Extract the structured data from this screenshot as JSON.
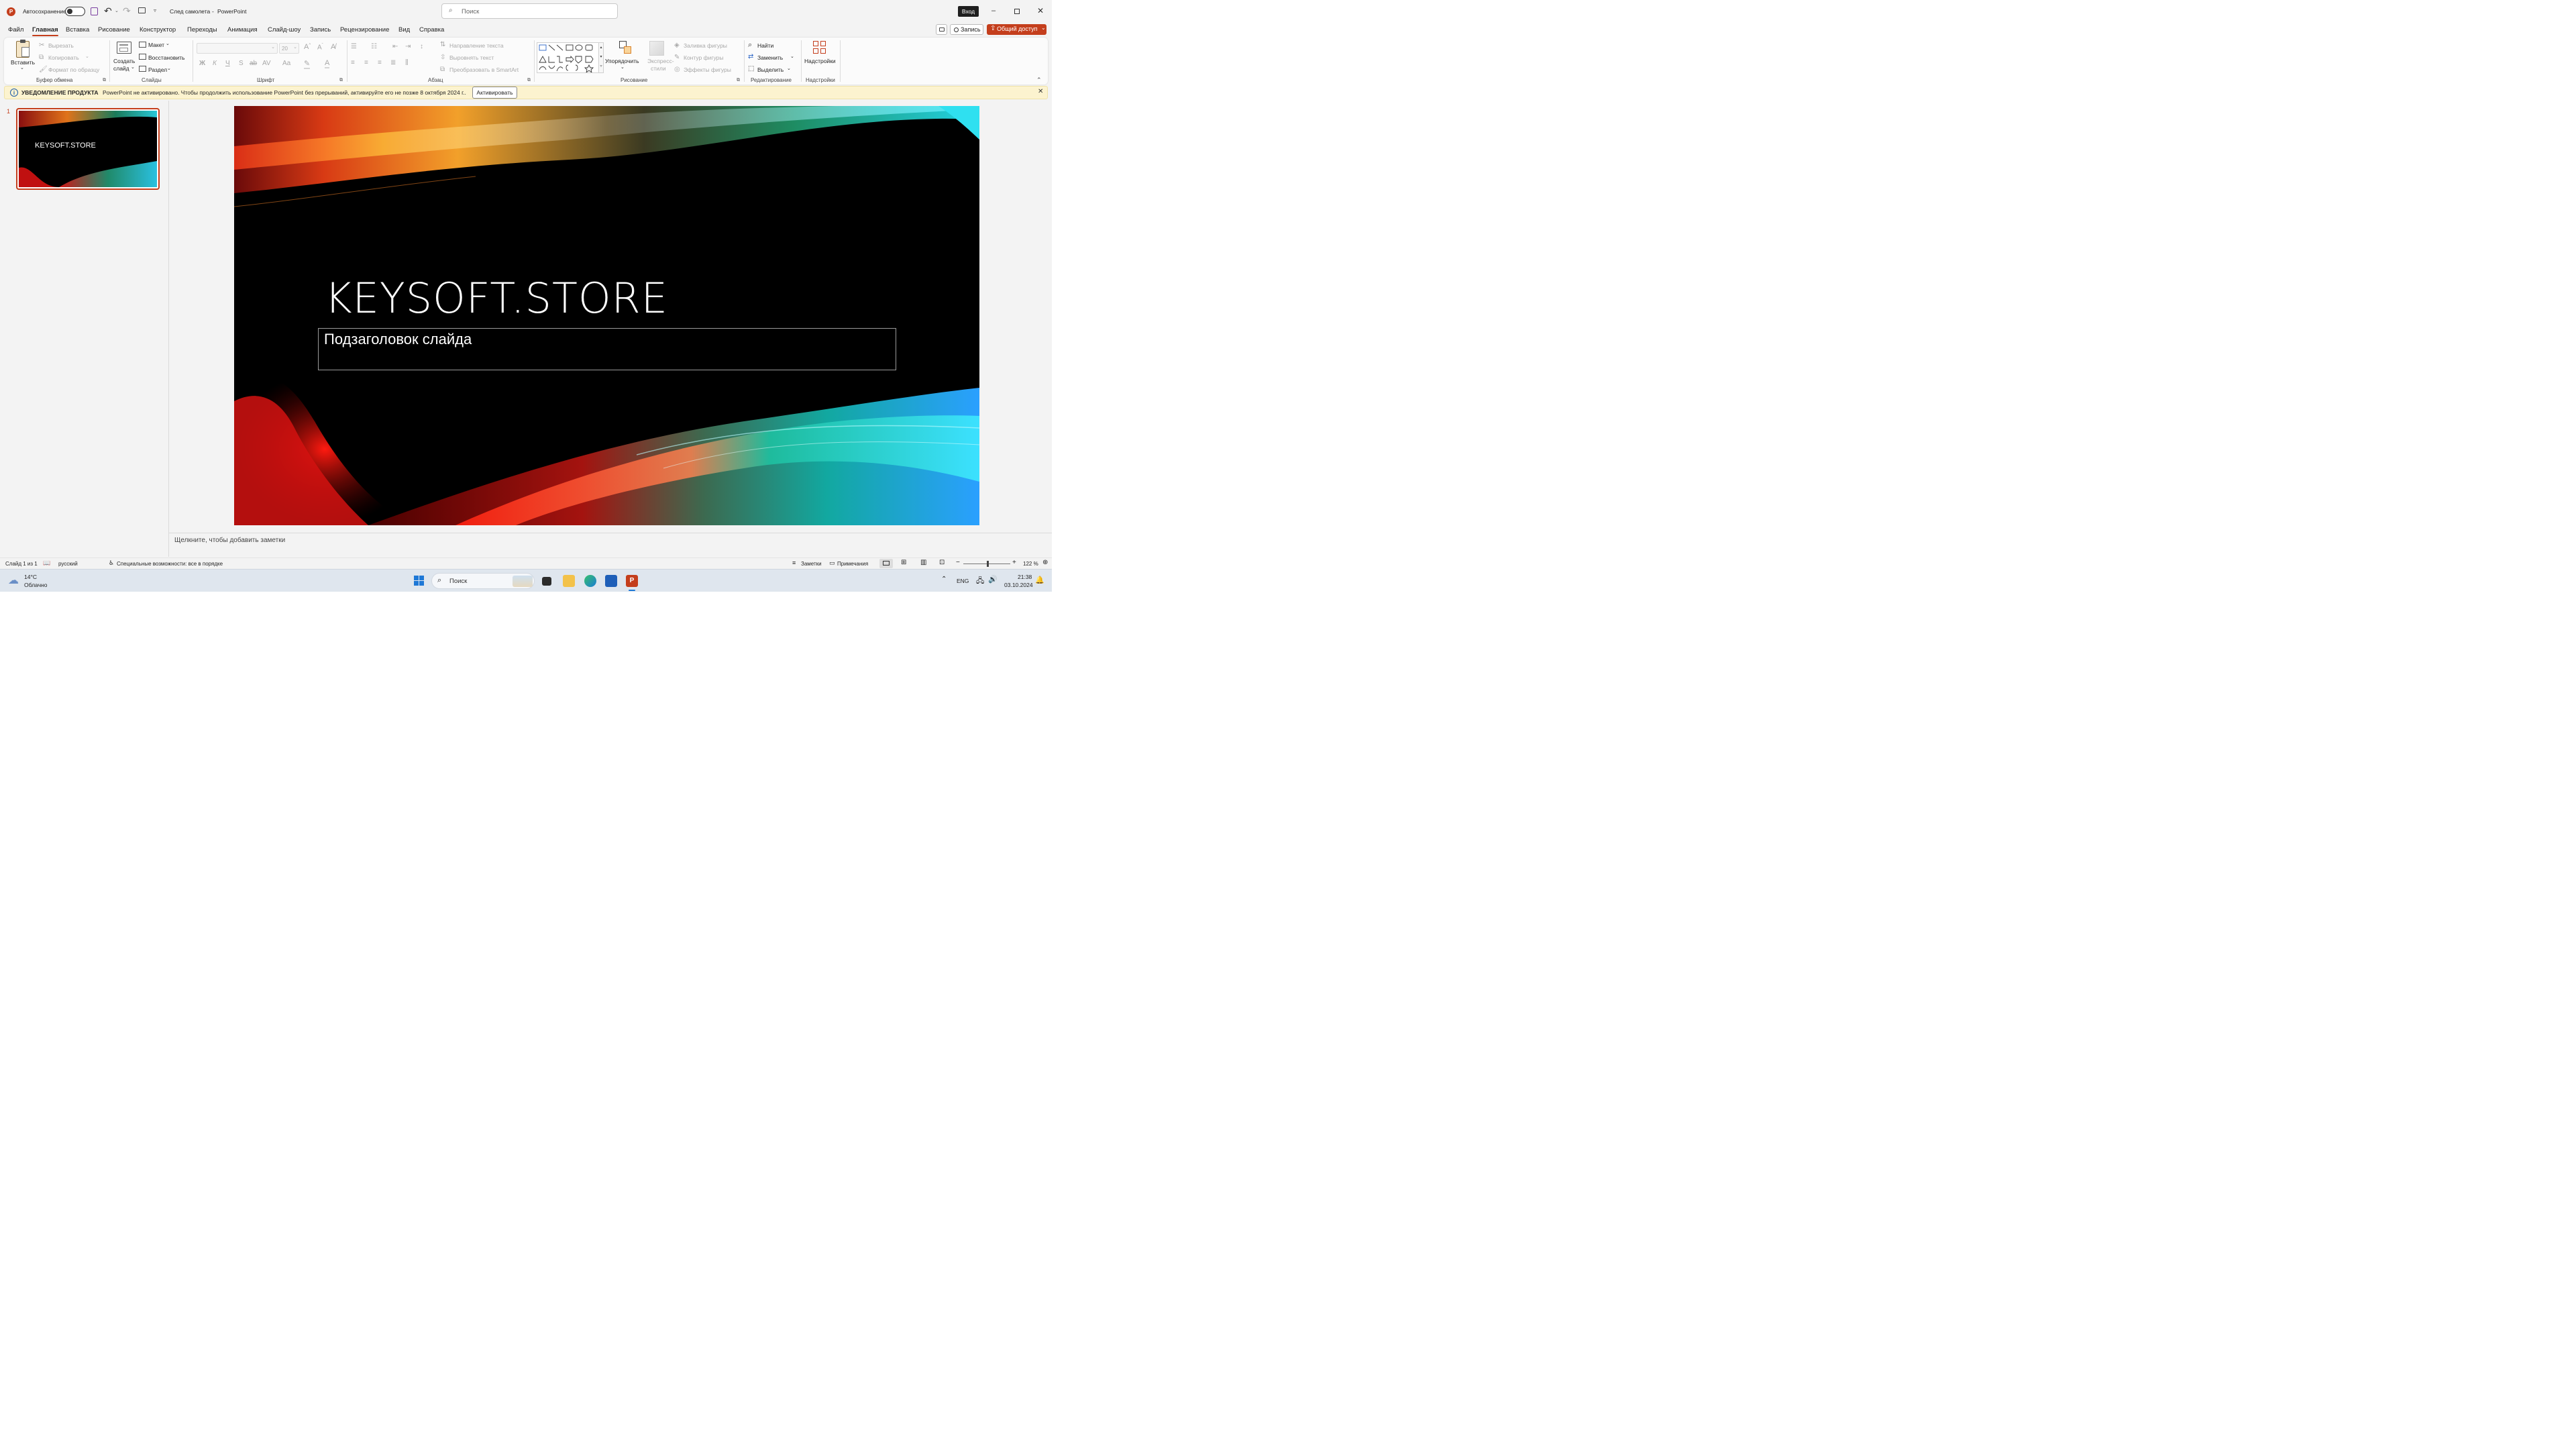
{
  "titlebar": {
    "autosave_label": "Автосохранение",
    "doc_title": "След самолета",
    "sep": "-",
    "app_name": "PowerPoint",
    "search_placeholder": "Поиск",
    "signin_label": "Вход"
  },
  "tabs": [
    "Файл",
    "Главная",
    "Вставка",
    "Рисование",
    "Конструктор",
    "Переходы",
    "Анимация",
    "Слайд-шоу",
    "Запись",
    "Рецензирование",
    "Вид",
    "Справка"
  ],
  "record_label": "Запись",
  "share_label": "Общий доступ",
  "ribbon": {
    "paste": "Вставить",
    "cut": "Вырезать",
    "copy": "Копировать",
    "format_painter": "Формат по образцу",
    "clipboard_group": "Буфер обмена",
    "new_slide_1": "Создать",
    "new_slide_2": "слайд",
    "layout": "Макет",
    "reset": "Восстановить",
    "section": "Раздел",
    "slides_group": "Слайды",
    "font_size": "20",
    "bold": "Ж",
    "italic": "К",
    "underline": "Ч",
    "strike": "S",
    "font_group": "Шрифт",
    "text_direction": "Направление текста",
    "align_text": "Выровнять текст",
    "smartart": "Преобразовать в SmartArt",
    "paragraph_group": "Абзац",
    "arrange": "Упорядочить",
    "quick_styles_1": "Экспресс-",
    "quick_styles_2": "стили",
    "shape_fill": "Заливка фигуры",
    "shape_outline": "Контур фигуры",
    "shape_effects": "Эффекты фигуры",
    "drawing_group": "Рисование",
    "find": "Найти",
    "replace": "Заменить",
    "select": "Выделить",
    "editing_group": "Редактирование",
    "addins": "Надстройки",
    "addins_group": "Надстройки"
  },
  "notice": {
    "title": "УВЕДОМЛЕНИЕ ПРОДУКТА",
    "text": "PowerPoint не активировано. Чтобы продолжить использование PowerPoint без прерываний, активируйте его не позже 8 октября 2024 г..",
    "button": "Активировать"
  },
  "thumbnail": {
    "number": "1",
    "title": "KEYSOFT.STORE"
  },
  "slide": {
    "title": "KEYSOFT.STORE",
    "subtitle": "Подзаголовок слайда"
  },
  "notes_placeholder": "Щелкните, чтобы добавить заметки",
  "status": {
    "slide_info": "Слайд 1 из 1",
    "language": "русский",
    "accessibility": "Специальные возможности: все в порядке",
    "notes": "Заметки",
    "comments": "Примечания",
    "zoom_minus": "−",
    "zoom_plus": "+",
    "zoom": "122 %"
  },
  "taskbar": {
    "temp": "14°C",
    "weather": "Облачно",
    "search": "Поиск",
    "lang": "ENG",
    "time": "21:38",
    "date": "03.10.2024"
  },
  "colors": {
    "accent": "#c43e1c",
    "share_bg": "#c43e1c",
    "notice_bg": "#fcf3cf"
  }
}
